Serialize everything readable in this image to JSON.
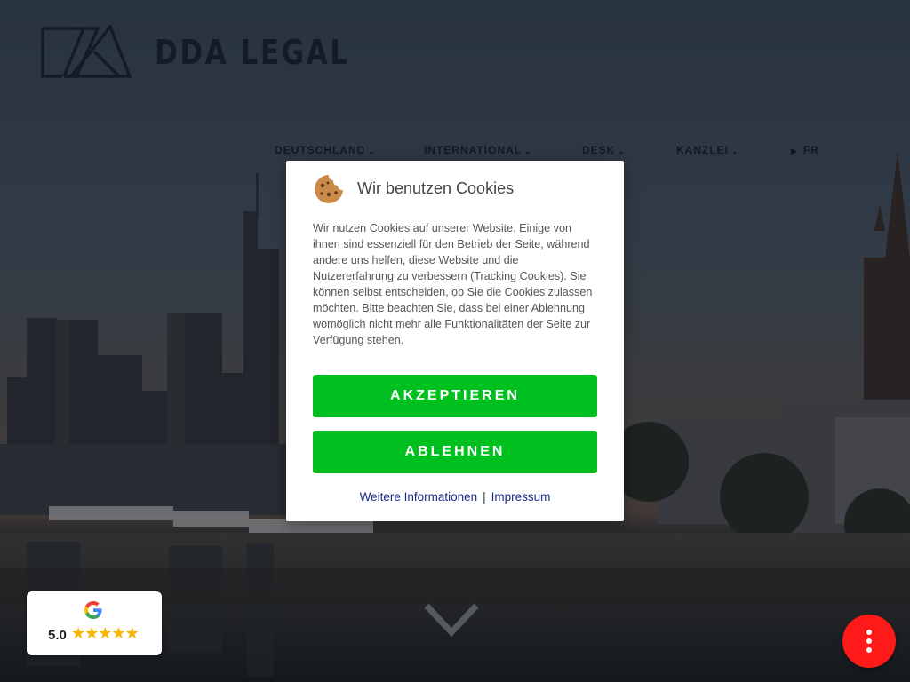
{
  "brand": {
    "name": "DDA LEGAL"
  },
  "nav": {
    "items": [
      {
        "label": "DEUTSCHLAND",
        "has_dropdown": true
      },
      {
        "label": "INTERNATIONAL",
        "has_dropdown": true
      },
      {
        "label": "DESK",
        "has_dropdown": true
      },
      {
        "label": "KANZLEI",
        "has_dropdown": true
      }
    ],
    "lang": {
      "icon": "play-icon",
      "label": "FR"
    }
  },
  "cookie_modal": {
    "title": "Wir benutzen Cookies",
    "icon": "cookie-icon",
    "text": "Wir nutzen Cookies auf unserer Website. Einige von ihnen sind essenziell für den Betrieb der Seite, während andere uns helfen, diese Website und die Nutzererfahrung zu verbessern (Tracking Cookies). Sie können selbst entscheiden, ob Sie die Cookies zulassen möchten. Bitte beachten Sie, dass bei einer Ablehnung womöglich nicht mehr alle Funktionalitäten der Seite zur Verfügung stehen.",
    "accept_label": "AKZEPTIEREN",
    "decline_label": "ABLEHNEN",
    "more_info_label": "Weitere Informationen",
    "separator": "|",
    "imprint_label": "Impressum",
    "button_color": "#00c01f"
  },
  "review_badge": {
    "score": "5.0",
    "rating": 5,
    "icon": "google-g-icon",
    "star_color": "#f5b400"
  },
  "fab": {
    "icon": "more-vertical-icon",
    "color": "#ff1a1a"
  },
  "scroll_indicator": {
    "icon": "chevron-down-icon"
  }
}
